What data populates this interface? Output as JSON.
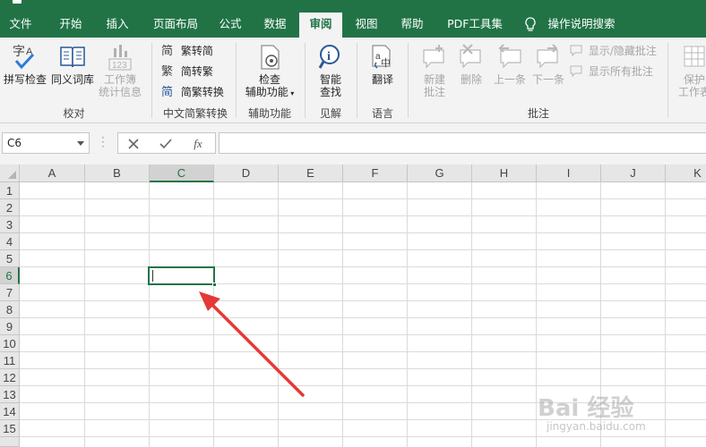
{
  "tabs": [
    {
      "label": "文件"
    },
    {
      "label": "开始"
    },
    {
      "label": "插入"
    },
    {
      "label": "页面布局"
    },
    {
      "label": "公式"
    },
    {
      "label": "数据"
    },
    {
      "label": "审阅",
      "active": true
    },
    {
      "label": "视图"
    },
    {
      "label": "帮助"
    },
    {
      "label": "PDF工具集"
    },
    {
      "label": "操作说明搜索"
    }
  ],
  "ribbon": {
    "proofing": {
      "spell_check": "拼写检查",
      "thesaurus": "同义词库",
      "workbook_stats_1": "工作簿",
      "workbook_stats_2": "统计信息",
      "group_label": "校对"
    },
    "chinese_conversion": {
      "trad_to_simp": "繁转简",
      "simp_to_trad": "简转繁",
      "convert": "简繁转换",
      "group_label": "中文简繁转换"
    },
    "accessibility": {
      "check_1": "检查",
      "check_2": "辅助功能",
      "group_label": "辅助功能"
    },
    "insights": {
      "smart_lookup_1": "智能",
      "smart_lookup_2": "查找",
      "group_label": "见解"
    },
    "language": {
      "translate": "翻译",
      "group_label": "语言"
    },
    "comments": {
      "new_1": "新建",
      "new_2": "批注",
      "delete": "删除",
      "previous": "上一条",
      "next": "下一条",
      "show_hide": "显示/隐藏批注",
      "show_all": "显示所有批注",
      "group_label": "批注"
    },
    "protect": {
      "protect_1": "保护",
      "protect_2": "工作表"
    }
  },
  "formula_bar": {
    "name_box": "C6",
    "fx_label": "fx",
    "value": ""
  },
  "grid": {
    "columns": [
      "A",
      "B",
      "C",
      "D",
      "E",
      "F",
      "G",
      "H",
      "I",
      "J",
      "K"
    ],
    "rows": [
      "1",
      "2",
      "3",
      "4",
      "5",
      "6",
      "7",
      "8",
      "9",
      "10",
      "11",
      "12",
      "13",
      "14",
      "15"
    ],
    "active_cell": "C6",
    "selected_column": "C",
    "selected_row": "6"
  },
  "watermark": {
    "brand": "Bai 经验",
    "url": "jingyan.baidu.com"
  },
  "colors": {
    "accent": "#217346",
    "arrow": "#e53935"
  }
}
